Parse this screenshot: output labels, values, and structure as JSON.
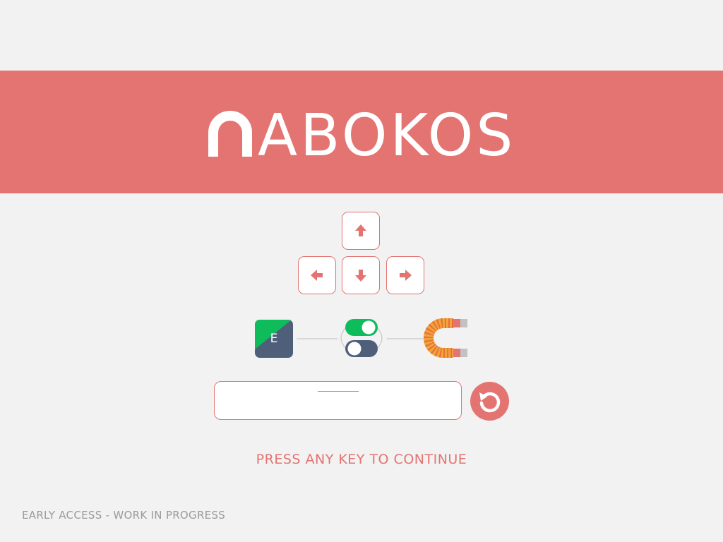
{
  "title": "NABOKOS",
  "colors": {
    "accent": "#e37472",
    "background": "#f2f2f2",
    "green": "#0ebc5b",
    "slate": "#4f5f7a"
  },
  "controls": {
    "arrows": [
      {
        "name": "up",
        "icon": "arrow-up-icon"
      },
      {
        "name": "left",
        "icon": "arrow-left-icon"
      },
      {
        "name": "down",
        "icon": "arrow-down-icon"
      },
      {
        "name": "right",
        "icon": "arrow-right-icon"
      }
    ],
    "ekey_label": "E"
  },
  "input": {
    "value": ""
  },
  "prompt": "PRESS ANY KEY TO CONTINUE",
  "footer": "EARLY ACCESS - WORK IN PROGRESS"
}
